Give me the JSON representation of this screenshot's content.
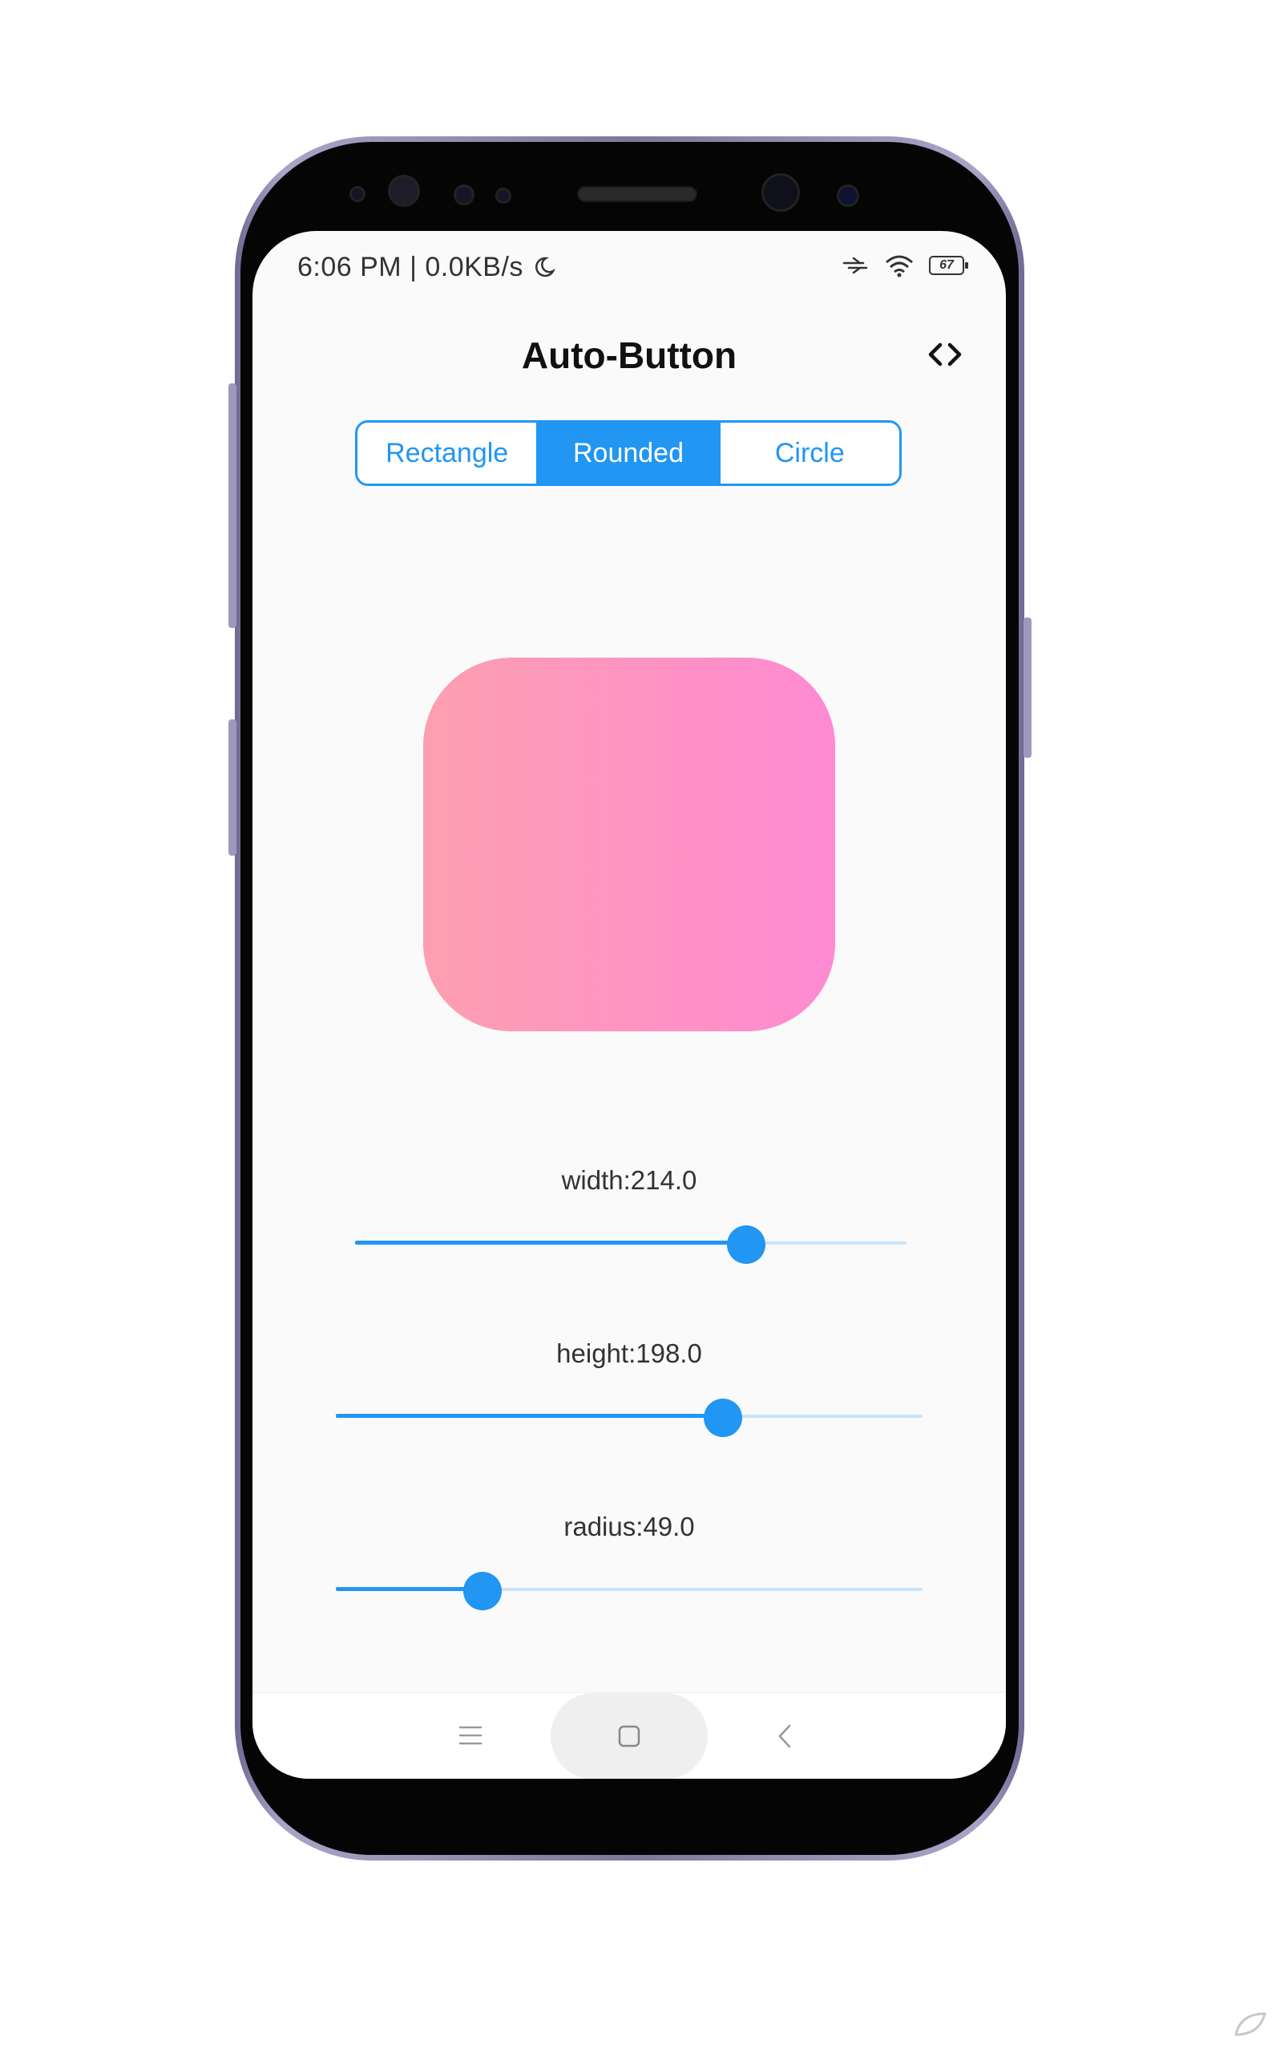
{
  "status_bar": {
    "time_speed": "6:06  PM  |  0.0KB/s",
    "battery": "67"
  },
  "app_bar": {
    "title": "Auto-Button",
    "action_icon": "code-icon"
  },
  "shape_selector": {
    "options": [
      "Rectangle",
      "Rounded",
      "Circle"
    ],
    "selected": "Rounded"
  },
  "preview": {
    "gradient_start": "#fd9fb0",
    "gradient_end": "#fe8ad3"
  },
  "sliders": [
    {
      "label": "width:214.0",
      "fraction": 0.71
    },
    {
      "label": "height:198.0",
      "fraction": 0.66
    },
    {
      "label": "radius:49.0",
      "fraction": 0.25
    }
  ],
  "nav_bar": {
    "menu_icon": "menu-icon",
    "home_icon": "home-icon",
    "back_icon": "back-icon"
  },
  "colors": {
    "accent": "#2196f3",
    "track_inactive": "#c9e3fb"
  }
}
